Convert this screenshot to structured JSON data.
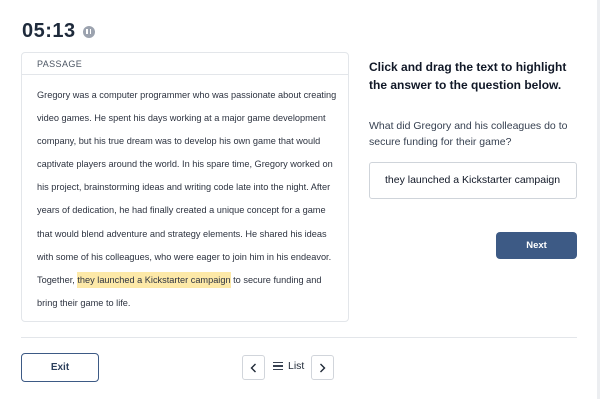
{
  "timer": {
    "time": "05:13",
    "pause_icon": "pause-icon"
  },
  "passage": {
    "header": "PASSAGE",
    "text_before": "Gregory was a computer programmer who was passionate about creating video games. He spent his days working at a major game development company, but his true dream was to develop his own game that would captivate players around the world. In his spare time, Gregory worked on his project, brainstorming ideas and writing code late into the night. After years of dedication, he had finally created a unique concept for a game that would blend adventure and strategy elements. He shared his ideas with some of his colleagues, who were eager to join him in his endeavor. Together, ",
    "highlight": "they launched a Kickstarter campaign",
    "text_after": " to secure funding and bring their game to life.",
    "highlight_color": "#fde9a8"
  },
  "instruction": "Click and drag the text to highlight the answer to the question below.",
  "question": "What did Gregory and his colleagues do to secure funding for their game?",
  "answer": "they launched a Kickstarter campaign",
  "buttons": {
    "next": "Next",
    "exit": "Exit"
  },
  "pagination": {
    "list_label": "List",
    "prev_icon": "chevron-left-icon",
    "next_icon": "chevron-right-icon",
    "list_icon": "list-icon"
  },
  "colors": {
    "primary": "#3d5a85",
    "timer": "#1e2a3b"
  }
}
